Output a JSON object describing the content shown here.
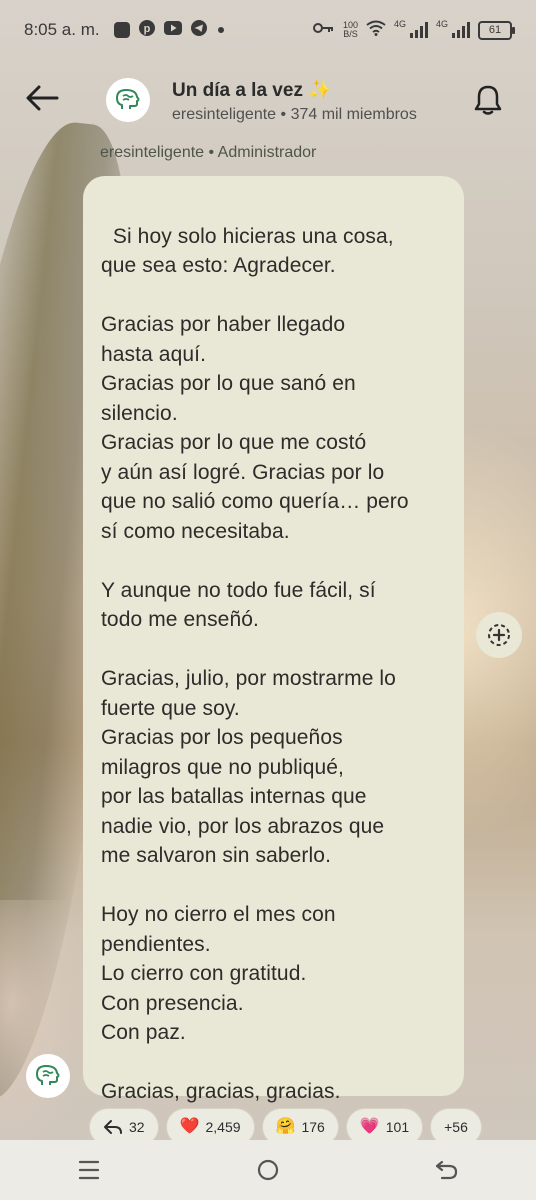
{
  "status_bar": {
    "time": "8:05 a. m.",
    "net_speed_value": "100",
    "net_speed_unit": "B/S",
    "sim1_label": "4G",
    "sim2_label": "4G",
    "battery": "61"
  },
  "header": {
    "title": "Un día a la vez ✨",
    "subtitle": "eresinteligente • 374 mil miembros"
  },
  "message": {
    "author_label": "eresinteligente • Administrador",
    "text": "Si hoy solo hicieras una cosa,\nque sea esto: Agradecer.\n\nGracias por haber llegado\nhasta aquí.\nGracias por lo que sanó en\nsilencio.\nGracias por lo que me costó\ny aún así logré. Gracias por lo\nque no salió como quería… pero\nsí como necesitaba.\n\nY aunque no todo fue fácil, sí\ntodo me enseñó.\n\nGracias, julio, por mostrarme lo\nfuerte que soy.\nGracias por los pequeños\nmilagros que no publiqué,\npor las batallas internas que\nnadie vio, por los abrazos que\nme salvaron sin saberlo.\n\nHoy no cierro el mes con\npendientes.\nLo cierro con gratitud.\nCon presencia.\nCon paz.\n\nGracias, gracias, gracias."
  },
  "reactions": [
    {
      "emoji": "",
      "count": "32"
    },
    {
      "emoji": "❤️",
      "count": "2,459"
    },
    {
      "emoji": "🤗",
      "count": "176"
    },
    {
      "emoji": "💗",
      "count": "101"
    },
    {
      "emoji": "",
      "count": "+56"
    }
  ],
  "colors": {
    "bubble": "#e9e7d5",
    "text": "#2c2c2a",
    "heart": "#e0243a",
    "pink_heart": "#e0458a"
  }
}
